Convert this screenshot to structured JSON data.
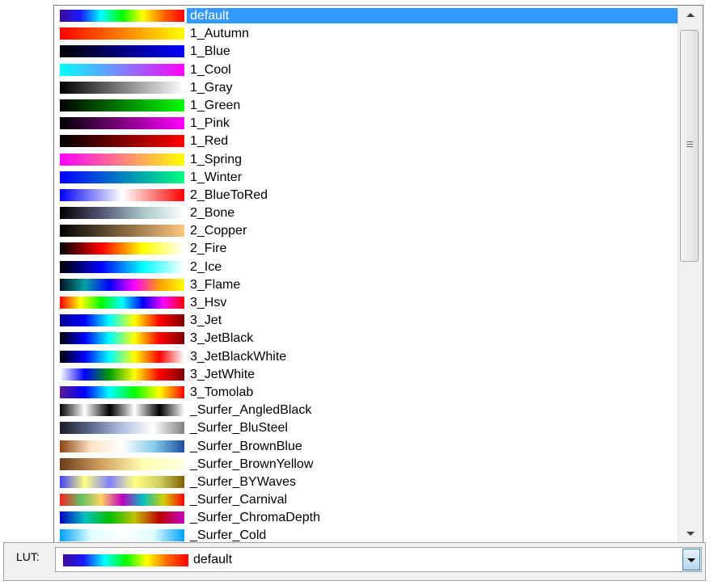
{
  "dropdown": {
    "items": [
      {
        "label": "default",
        "selected": true,
        "colors": [
          "#3d0a9a",
          "#1a1aff",
          "#00ffff",
          "#00ff00",
          "#ffff00",
          "#ff6600",
          "#ff0000"
        ]
      },
      {
        "label": "1_Autumn",
        "colors": [
          "#ff0000",
          "#ffff00"
        ]
      },
      {
        "label": "1_Blue",
        "colors": [
          "#000000",
          "#0000ff"
        ]
      },
      {
        "label": "1_Cool",
        "colors": [
          "#00ffff",
          "#ff00ff"
        ]
      },
      {
        "label": "1_Gray",
        "colors": [
          "#000000",
          "#ffffff"
        ]
      },
      {
        "label": "1_Green",
        "colors": [
          "#000000",
          "#00ff00"
        ]
      },
      {
        "label": "1_Pink",
        "colors": [
          "#000000",
          "#ff00ff"
        ]
      },
      {
        "label": "1_Red",
        "colors": [
          "#000000",
          "#ff0000"
        ]
      },
      {
        "label": "1_Spring",
        "colors": [
          "#ff00ff",
          "#ffff00"
        ]
      },
      {
        "label": "1_Winter",
        "colors": [
          "#0000ff",
          "#00ff80"
        ]
      },
      {
        "label": "2_BlueToRed",
        "colors": [
          "#0000ff",
          "#ffffff",
          "#ff0000"
        ]
      },
      {
        "label": "2_Bone",
        "colors": [
          "#000000",
          "#545474",
          "#a7c7c7",
          "#ffffff"
        ]
      },
      {
        "label": "2_Copper",
        "colors": [
          "#000000",
          "#ffc77f"
        ]
      },
      {
        "label": "2_Fire",
        "colors": [
          "#000000",
          "#ff0000",
          "#ffff00",
          "#ffffff"
        ]
      },
      {
        "label": "2_Ice",
        "colors": [
          "#000000",
          "#0000ff",
          "#00ffff",
          "#ffffff"
        ]
      },
      {
        "label": "3_Flame",
        "colors": [
          "#001020",
          "#00a0a0",
          "#0000ff",
          "#ff00ff",
          "#ffa000",
          "#ffff00"
        ]
      },
      {
        "label": "3_Hsv",
        "colors": [
          "#ff0000",
          "#ffff00",
          "#00ff00",
          "#00ffff",
          "#0000ff",
          "#ff00ff",
          "#ff0000"
        ]
      },
      {
        "label": "3_Jet",
        "colors": [
          "#00008f",
          "#0000ff",
          "#00ffff",
          "#ffff00",
          "#ff0000",
          "#800000"
        ]
      },
      {
        "label": "3_JetBlack",
        "colors": [
          "#000000",
          "#0000ff",
          "#00ffff",
          "#ffff00",
          "#ff0000",
          "#800000"
        ]
      },
      {
        "label": "3_JetBlackWhite",
        "colors": [
          "#000000",
          "#0000ff",
          "#00ffff",
          "#ffff00",
          "#ff0000",
          "#ffffff"
        ]
      },
      {
        "label": "3_JetWhite",
        "colors": [
          "#ffffff",
          "#0000ff",
          "#00a000",
          "#ffff00",
          "#ff0000",
          "#800000"
        ]
      },
      {
        "label": "3_Tomolab",
        "colors": [
          "#5b1a8f",
          "#0000ff",
          "#00ffff",
          "#00ff00",
          "#ffff00",
          "#ff0000"
        ]
      },
      {
        "label": "_Surfer_AngledBlack",
        "colors": [
          "#000000",
          "#ffffff",
          "#000000",
          "#ffffff",
          "#000000",
          "#ffffff"
        ]
      },
      {
        "label": "_Surfer_BluSteel",
        "colors": [
          "#1a1a2a",
          "#5a6a8a",
          "#b0c0e0",
          "#ffffff",
          "#808080"
        ]
      },
      {
        "label": "_Surfer_BrownBlue",
        "colors": [
          "#8b4513",
          "#ffe4c4",
          "#ffffff",
          "#87ceeb",
          "#1e4fa0"
        ]
      },
      {
        "label": "_Surfer_BrownYellow",
        "colors": [
          "#6b3a1a",
          "#d2a060",
          "#ffffb0",
          "#ffffe0"
        ]
      },
      {
        "label": "_Surfer_BYWaves",
        "colors": [
          "#4040ff",
          "#ffff80",
          "#8080ff",
          "#ffff80",
          "#d0d060",
          "#806000"
        ]
      },
      {
        "label": "_Surfer_Carnival",
        "colors": [
          "#ff2020",
          "#60c060",
          "#ffd060",
          "#c000c0",
          "#00c0c0",
          "#d0d000",
          "#ff0000"
        ]
      },
      {
        "label": "_Surfer_ChromaDepth",
        "colors": [
          "#0000c0",
          "#00c0c0",
          "#00c000",
          "#c0c000",
          "#c00000",
          "#c000c0"
        ]
      },
      {
        "label": "_Surfer_Cold",
        "colors": [
          "#00a0ff",
          "#e0ffff",
          "#ffffff",
          "#e0ffff",
          "#00a0ff"
        ]
      }
    ]
  },
  "lut": {
    "label": "LUT:",
    "selected_label": "default",
    "selected_colors": [
      "#3d0a9a",
      "#1a1aff",
      "#00ffff",
      "#00ff00",
      "#ffff00",
      "#ff6600",
      "#ff0000"
    ]
  }
}
